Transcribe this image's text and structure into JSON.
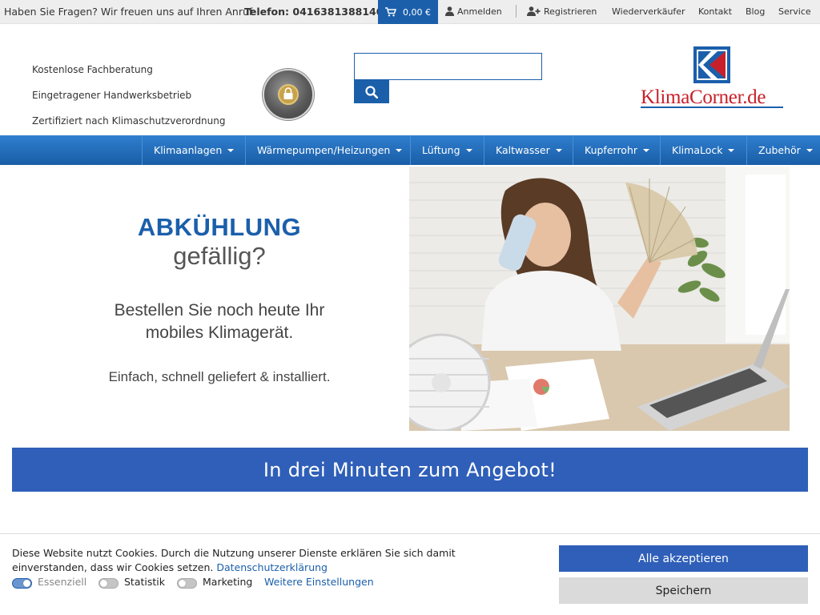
{
  "topbar": {
    "question": "Haben Sie Fragen? Wir freuen uns auf Ihren Anruf.",
    "phone": "Telefon: 0416381388140",
    "cart_total": "0,00 €",
    "login": "Anmelden",
    "register": "Registrieren",
    "links": [
      "Wiederverkäufer",
      "Kontakt",
      "Blog",
      "Service"
    ]
  },
  "header": {
    "features": [
      "Kostenlose Fachberatung",
      "Eingetragener Handwerksbetrieb",
      "Zertifiziert nach Klimaschutzverordnung"
    ],
    "badge_text": "SICHER EINKAUFEN · SSL Verschlüsselung",
    "search_value": "",
    "logo_text": "KlimaCorner.de"
  },
  "nav": {
    "items": [
      "Klimaanlagen",
      "Wärmepumpen/Heizungen",
      "Lüftung",
      "Kaltwasser",
      "Kupferrohr",
      "KlimaLock",
      "Zubehör"
    ]
  },
  "hero": {
    "title": "ABKÜHLUNG",
    "subtitle": "gefällig?",
    "line1": "Bestellen Sie noch heute Ihr",
    "line2": "mobiles Klimagerät.",
    "line3": "Einfach, schnell geliefert & installiert."
  },
  "cta": {
    "label": "In drei Minuten zum Angebot!"
  },
  "cookie": {
    "text": "Diese Website nutzt Cookies. Durch die Nutzung unserer Dienste erklären Sie sich damit einverstanden, dass wir Cookies setzen.",
    "privacy_link": "Datenschutzerklärung",
    "toggles": [
      {
        "label": "Essenziell",
        "on": true
      },
      {
        "label": "Statistik",
        "on": false
      },
      {
        "label": "Marketing",
        "on": false
      }
    ],
    "more_settings": "Weitere Einstellungen",
    "accept_all": "Alle akzeptieren",
    "save": "Speichern"
  },
  "colors": {
    "brand_blue": "#1b5fab",
    "cta_blue": "#2f5fb8",
    "logo_red": "#c8202a",
    "topbar_bg": "#eeeeee"
  }
}
